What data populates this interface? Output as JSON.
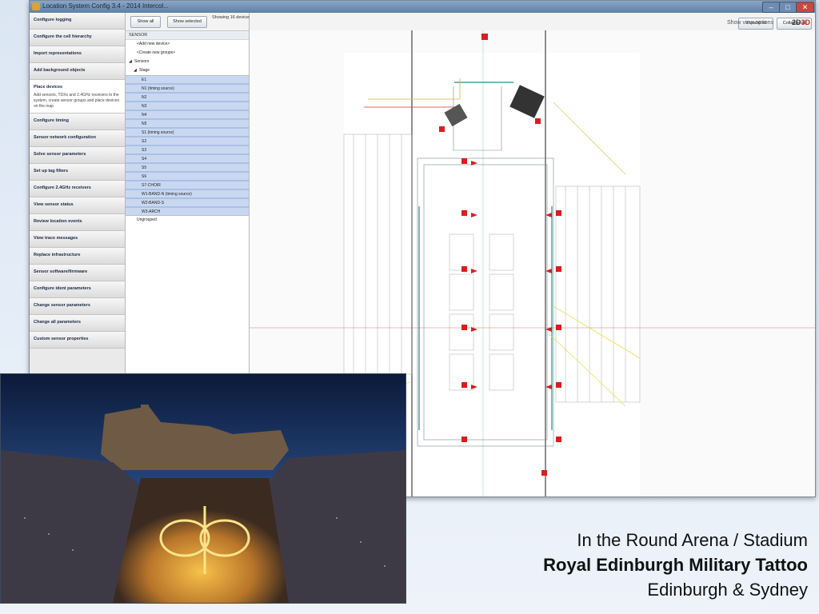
{
  "window": {
    "title": "Location System Config 3.4 - 2014 Intercol..."
  },
  "nav": {
    "items": [
      "Configure logging",
      "Configure the cell hierarchy",
      "Import representations",
      "Add background objects",
      "Place devices",
      "Configure timing",
      "Sensor network configuration",
      "Solve sensor parameters",
      "Set up tag filters",
      "Configure 2.4GHz receivers",
      "View sensor status",
      "Review location events",
      "View trace messages",
      "Replace infrastructure",
      "Sensor software/firmware",
      "Configure ident parameters",
      "Change sensor parameters",
      "Change all parameters",
      "Custom sensor properties"
    ],
    "active_description": "Add sensors, TDXs and 2.4GHz receivers to the system, create sensor groups and place devices on the map"
  },
  "toolbar": {
    "show_all": "Show all",
    "show_selected": "Show selected",
    "showing": "Showing 16 devices",
    "expand_all": "Expand all",
    "collapse_all": "Collapse all",
    "view_options": "Show view options",
    "view_2d": "2D",
    "view_3d": "3D"
  },
  "tree": {
    "header": "SENSOR",
    "add_device": "<Add new device>",
    "create_group": "<Create new groups>",
    "sensors": "Sensors",
    "stage": "Stage",
    "devices": [
      "E1",
      "N1 (timing source)",
      "N2",
      "N3",
      "N4",
      "N5",
      "S1 (timing source)",
      "S2",
      "S3",
      "S4",
      "S5",
      "S6",
      "S7-CHOIR",
      "W1-BAND-N (timing source)",
      "W2-BAND-S",
      "W3-ARCH"
    ],
    "ungrouped": "Ungrouped"
  },
  "colors": {
    "sensor_red": "#d81e1e",
    "selection": "#c9d8f0",
    "titlebar": "#6f8db2"
  },
  "caption": {
    "line1": "In the Round Arena / Stadium",
    "line2": "Royal Edinburgh Military Tattoo",
    "line3": "Edinburgh & Sydney"
  }
}
